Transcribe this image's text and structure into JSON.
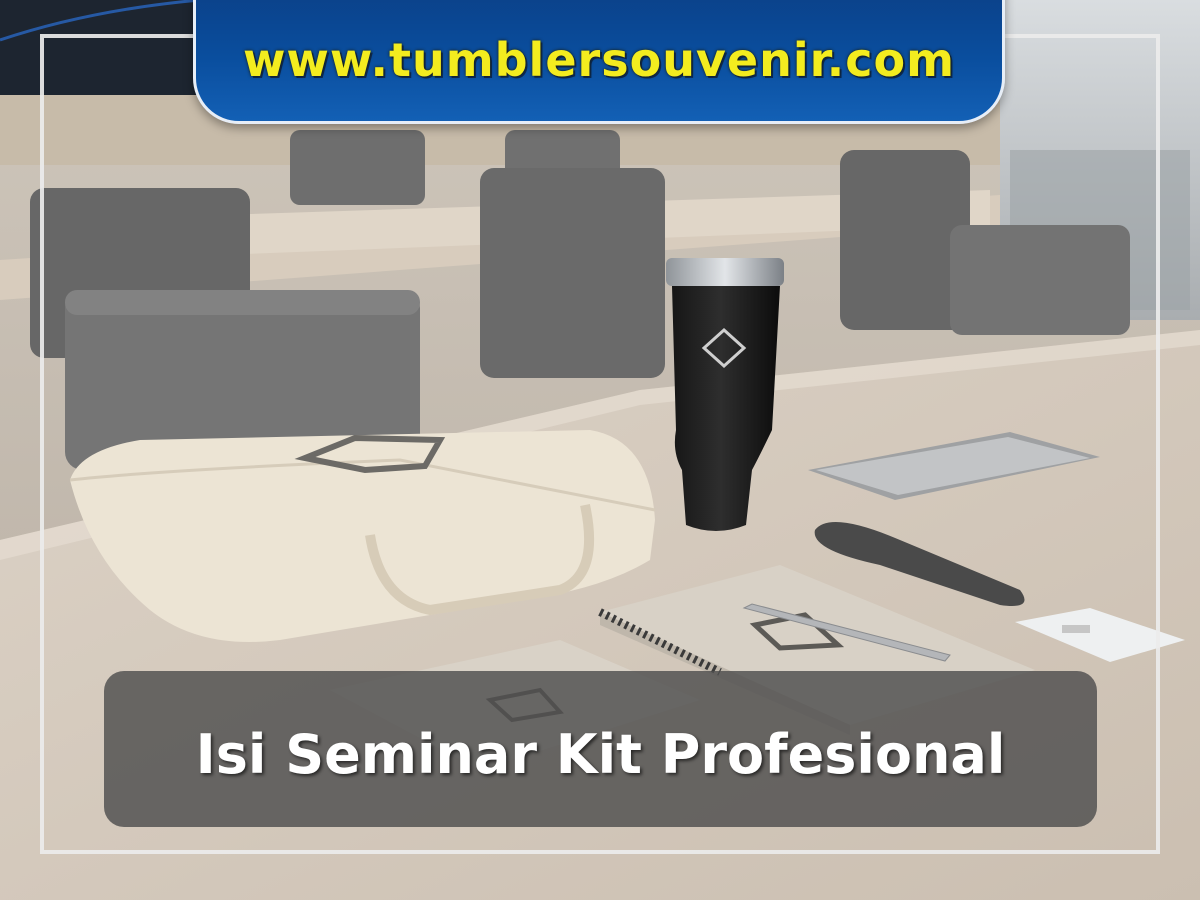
{
  "banner": {
    "url_text": "www.tumblersouvenir.com"
  },
  "caption": {
    "title": "Isi Seminar Kit Profesional"
  },
  "colors": {
    "banner_blue": "#0a4e9e",
    "url_yellow": "#f3ec1f",
    "caption_bg": "#4e4e4e"
  }
}
